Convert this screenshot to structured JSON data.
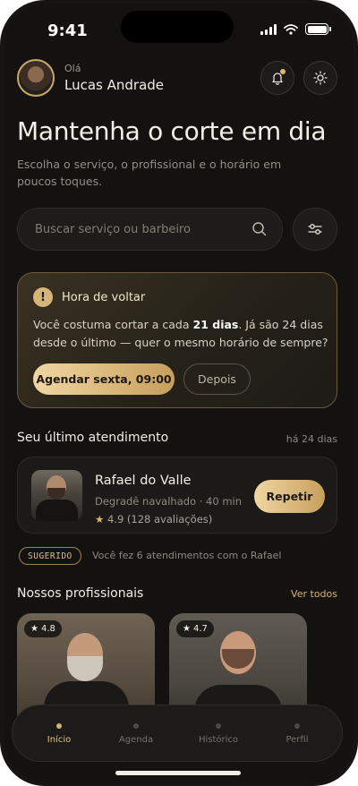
{
  "status_bar": {
    "time": "9:41"
  },
  "header": {
    "greeting": "Olá",
    "user_name": "Lucas Andrade"
  },
  "hero": {
    "title": "Mantenha o corte em dia",
    "subtitle": "Escolha o serviço, o profissional e o horário em poucos toques."
  },
  "search": {
    "placeholder": "Buscar serviço ou barbeiro"
  },
  "reminder": {
    "badge": "!",
    "title": "Hora de voltar",
    "text_before": "Você costuma cortar a cada ",
    "text_bold": "21 dias",
    "text_after": ". Já são 24 dias desde o último — quer o mesmo horário de sempre?",
    "primary_label": "Agendar sexta, 09:00",
    "secondary_label": "Depois"
  },
  "last_appointment": {
    "section_title": "Seu último atendimento",
    "ago": "há 24 dias",
    "barber_name": "Rafael do Valle",
    "service": "Degradê navalhado · 40 min",
    "rating": "4.9 (128 avaliações)",
    "repeat_label": "Repetir"
  },
  "suggestion": {
    "tag": "SUGERIDO",
    "text": "Você fez 6 atendimentos com o Rafael"
  },
  "professionals": {
    "section_title": "Nossos profissionais",
    "see_all": "Ver todos",
    "items": [
      {
        "rating": "4.8"
      },
      {
        "rating": "4.7"
      }
    ]
  },
  "tabs": [
    {
      "label": "Início",
      "active": true
    },
    {
      "label": "Agenda",
      "active": false
    },
    {
      "label": "Histórico",
      "active": false
    },
    {
      "label": "Perfil",
      "active": false
    }
  ],
  "colors": {
    "accent": "#d8b36e",
    "background": "#131211",
    "card": "#1b1a18"
  }
}
